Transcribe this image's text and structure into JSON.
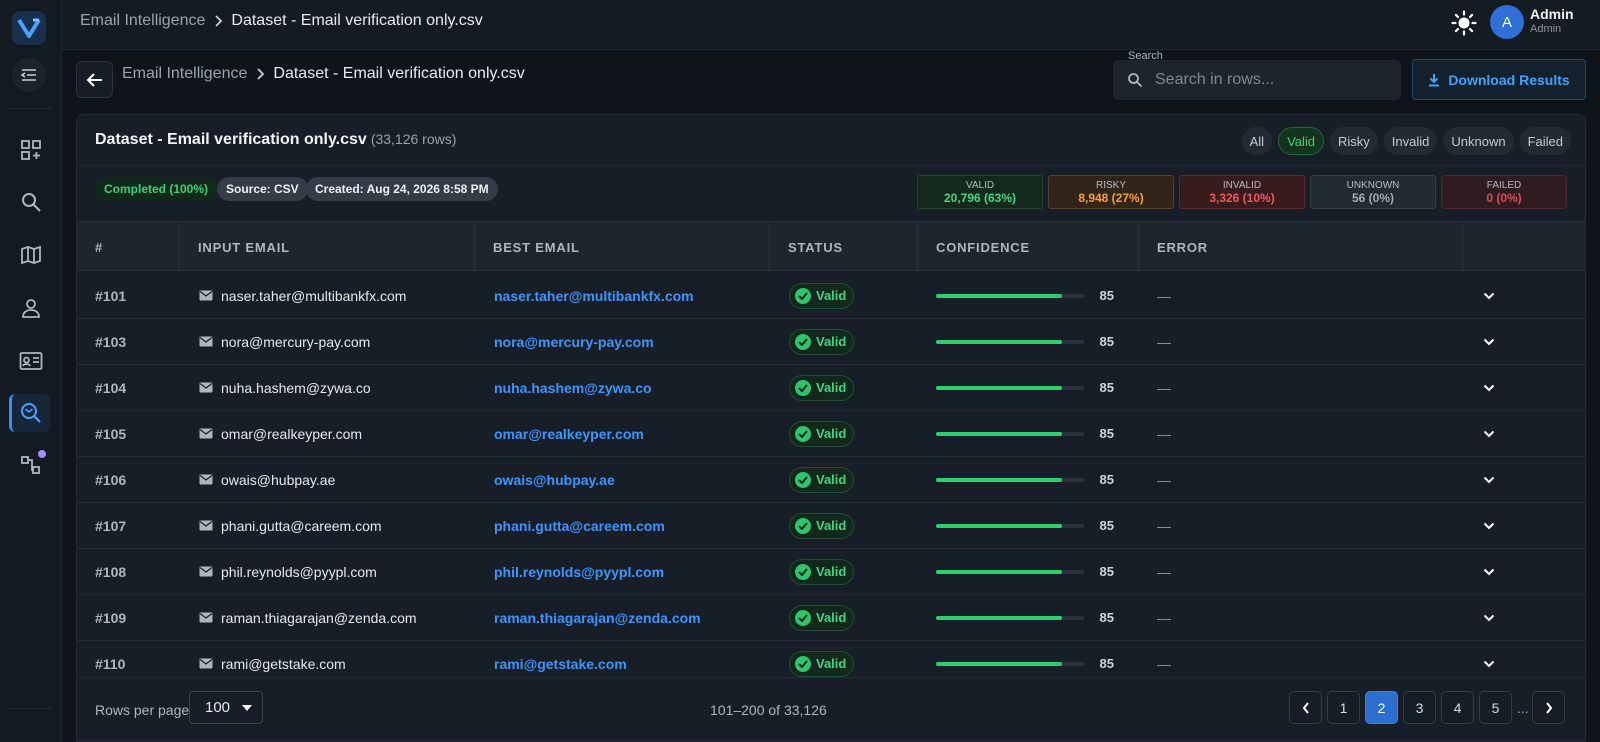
{
  "header": {
    "breadcrumb": [
      "Email Intelligence",
      "Dataset - Email verification only.csv"
    ],
    "user": {
      "initial": "A",
      "name": "Admin",
      "role": "Admin"
    }
  },
  "subheader": {
    "breadcrumb": [
      "Email Intelligence",
      "Dataset - Email verification only.csv"
    ],
    "search_label": "Search",
    "search_placeholder": "Search in rows...",
    "download_label": "Download Results"
  },
  "panel": {
    "title": "Dataset - Email verification only.csv",
    "row_count": "(33,126 rows)",
    "filters": [
      "All",
      "Valid",
      "Risky",
      "Invalid",
      "Unknown",
      "Failed"
    ],
    "active_filter": "Valid",
    "chips": {
      "status": "Completed (100%)",
      "source": "Source: CSV",
      "created": "Created: Aug 24, 2026 8:58 PM"
    },
    "stats": {
      "valid": {
        "label": "VALID",
        "value": "20,796 (63%)"
      },
      "risky": {
        "label": "RISKY",
        "value": "8,948 (27%)"
      },
      "invalid": {
        "label": "INVALID",
        "value": "3,326 (10%)"
      },
      "unknown": {
        "label": "UNKNOWN",
        "value": "56 (0%)"
      },
      "failed": {
        "label": "FAILED",
        "value": "0 (0%)"
      }
    }
  },
  "table": {
    "columns": [
      "#",
      "INPUT EMAIL",
      "BEST EMAIL",
      "STATUS",
      "CONFIDENCE",
      "ERROR"
    ],
    "rows": [
      {
        "num": "#101",
        "input": "naser.taher@multibankfx.com",
        "best": "naser.taher@multibankfx.com",
        "status": "Valid",
        "confidence": 85,
        "error": "—"
      },
      {
        "num": "#103",
        "input": "nora@mercury-pay.com",
        "best": "nora@mercury-pay.com",
        "status": "Valid",
        "confidence": 85,
        "error": "—"
      },
      {
        "num": "#104",
        "input": "nuha.hashem@zywa.co",
        "best": "nuha.hashem@zywa.co",
        "status": "Valid",
        "confidence": 85,
        "error": "—"
      },
      {
        "num": "#105",
        "input": "omar@realkeyper.com",
        "best": "omar@realkeyper.com",
        "status": "Valid",
        "confidence": 85,
        "error": "—"
      },
      {
        "num": "#106",
        "input": "owais@hubpay.ae",
        "best": "owais@hubpay.ae",
        "status": "Valid",
        "confidence": 85,
        "error": "—"
      },
      {
        "num": "#107",
        "input": "phani.gutta@careem.com",
        "best": "phani.gutta@careem.com",
        "status": "Valid",
        "confidence": 85,
        "error": "—"
      },
      {
        "num": "#108",
        "input": "phil.reynolds@pyypl.com",
        "best": "phil.reynolds@pyypl.com",
        "status": "Valid",
        "confidence": 85,
        "error": "—"
      },
      {
        "num": "#109",
        "input": "raman.thiagarajan@zenda.com",
        "best": "raman.thiagarajan@zenda.com",
        "status": "Valid",
        "confidence": 85,
        "error": "—"
      },
      {
        "num": "#110",
        "input": "rami@getstake.com",
        "best": "rami@getstake.com",
        "status": "Valid",
        "confidence": 85,
        "error": "—"
      }
    ]
  },
  "footer": {
    "rows_per_page_label": "Rows per page",
    "rows_per_page": "100",
    "range": "101–200 of 33,126",
    "pages": [
      "1",
      "2",
      "3",
      "4",
      "5"
    ],
    "current_page": "2",
    "ellipsis": "..."
  },
  "icons": {
    "logo": "logo-v-icon",
    "nav": [
      "dashboard-add-icon",
      "search-icon",
      "map-icon",
      "user-icon",
      "contact-card-icon",
      "email-search-icon",
      "workflow-icon"
    ],
    "theme": "sun-icon"
  },
  "colors": {
    "accent": "#3c96ff",
    "valid": "#45d27f",
    "risky": "#f3a13a",
    "invalid": "#f0595c"
  }
}
